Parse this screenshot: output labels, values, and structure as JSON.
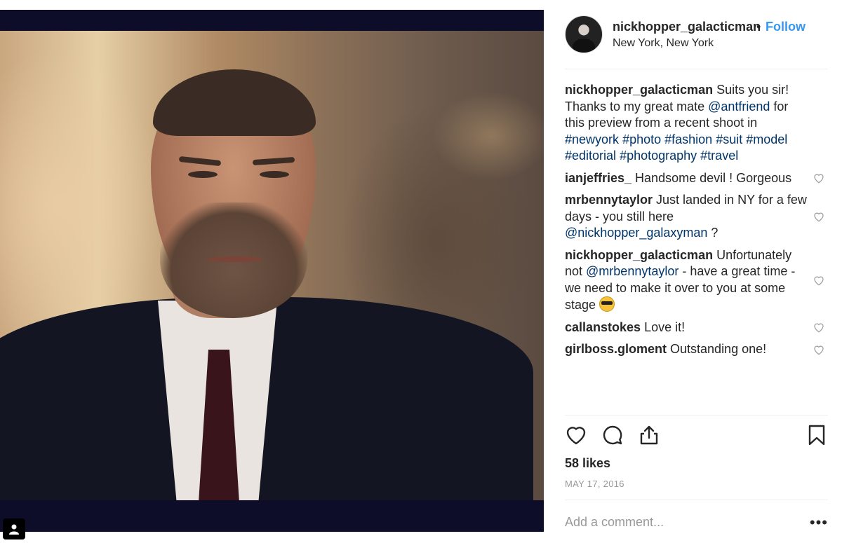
{
  "post": {
    "username": "nickhopper_galacticman",
    "dot": "•",
    "follow_label": "Follow",
    "location": "New York, New York"
  },
  "caption": {
    "username": "nickhopper_galacticman",
    "text1": " Suits you sir! Thanks to my great mate ",
    "mention": "@antfriend",
    "text2": " for this preview from a recent shoot in ",
    "tag1": "#newyork",
    "tag2": "#photo",
    "tag3": "#fashion",
    "tag4": "#suit",
    "tag5": "#model",
    "tag6": "#editorial",
    "tag7": "#photography",
    "tag8": "#travel"
  },
  "comments": [
    {
      "username": "ianjeffries_",
      "text": " Handsome devil ! Gorgeous"
    },
    {
      "username": "mrbennytaylor",
      "text": " Just landed in NY for a few days - you still here ",
      "mention": "@nickhopper_galaxyman",
      "text_after": " ?"
    },
    {
      "username": "nickhopper_galacticman",
      "text": " Unfortunately not ",
      "mention": "@mrbennytaylor",
      "text_after": " - have a great time - we need to make it over to you at some stage "
    },
    {
      "username": "callanstokes",
      "text": " Love it!"
    },
    {
      "username": "girlboss.gloment",
      "text": " Outstanding one!"
    }
  ],
  "stats": {
    "likes": "58 likes",
    "date": "MAY 17, 2016"
  },
  "composer": {
    "placeholder": "Add a comment...",
    "more": "•••"
  },
  "icons": {
    "like": "heart-icon",
    "comment": "comment-bubble-icon",
    "share": "share-upload-icon",
    "save": "bookmark-icon",
    "comment_like": "heart-outline-icon",
    "user_tag": "person-icon",
    "emoji": "sunglasses-emoji-icon"
  },
  "colors": {
    "link": "#003569",
    "follow": "#3897f0",
    "muted": "#999999"
  }
}
